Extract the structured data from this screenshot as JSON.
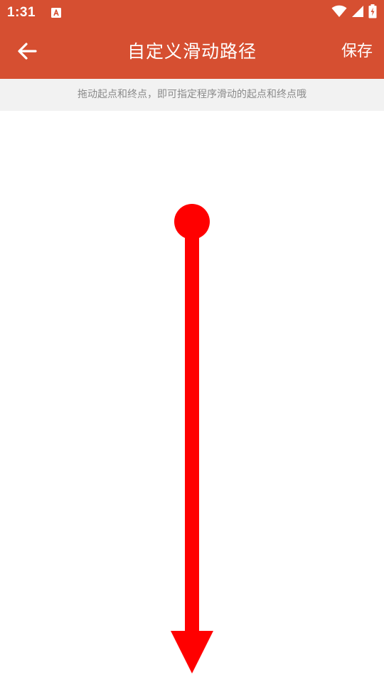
{
  "status_bar": {
    "time": "1:31",
    "icons": [
      "a-notification-icon",
      "wifi-icon",
      "signal-icon",
      "battery-icon"
    ]
  },
  "app_bar": {
    "back_icon": "arrow-left-icon",
    "title": "自定义滑动路径",
    "save_label": "保存"
  },
  "hint": {
    "text": "拖动起点和终点，即可指定程序滑动的起点和终点哦"
  },
  "colors": {
    "app_bar": "#d64f31",
    "hint_background": "#f2f2f2",
    "hint_text": "#8a8a8a",
    "path": "#ff0000"
  }
}
